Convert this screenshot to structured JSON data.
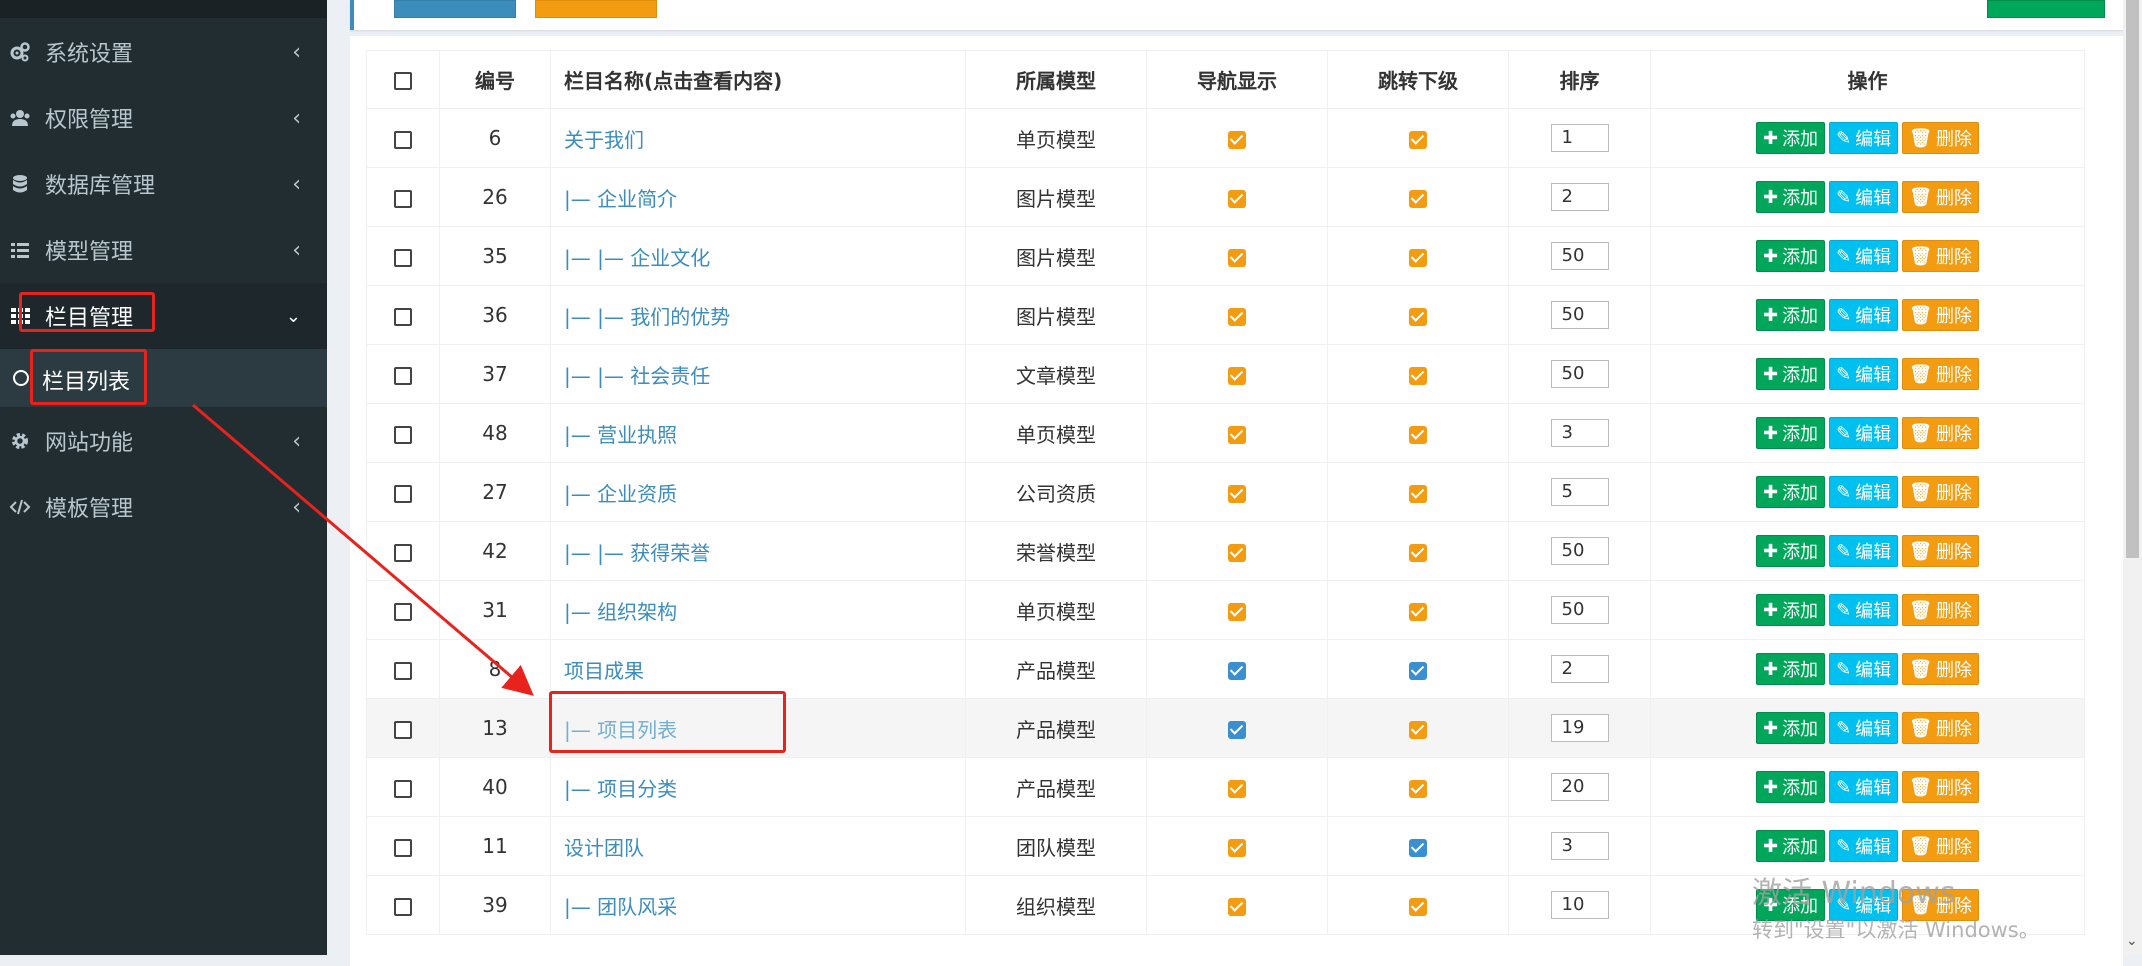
{
  "sidebar": {
    "items": [
      {
        "label": "系统设置",
        "icon": "cogs-icon"
      },
      {
        "label": "权限管理",
        "icon": "users-icon"
      },
      {
        "label": "数据库管理",
        "icon": "database-icon"
      },
      {
        "label": "模型管理",
        "icon": "list-icon"
      },
      {
        "label": "栏目管理",
        "icon": "grid-icon"
      },
      {
        "label": "网站功能",
        "icon": "gear-icon"
      },
      {
        "label": "模板管理",
        "icon": "code-icon"
      }
    ],
    "sub_item": {
      "label": "栏目列表"
    }
  },
  "table": {
    "headers": {
      "id": "编号",
      "name": "栏目名称(点击查看内容)",
      "model": "所属模型",
      "nav": "导航显示",
      "jump": "跳转下级",
      "sort": "排序",
      "ops": "操作"
    },
    "op_labels": {
      "add": "添加",
      "edit": "编辑",
      "delete": "删除"
    },
    "rows": [
      {
        "id": "6",
        "name": "关于我们",
        "model": "单页模型",
        "nav": "orange",
        "jump": "orange",
        "sort": "1"
      },
      {
        "id": "26",
        "name": "|— 企业简介",
        "model": "图片模型",
        "nav": "orange",
        "jump": "orange",
        "sort": "2"
      },
      {
        "id": "35",
        "name": "|— |— 企业文化",
        "model": "图片模型",
        "nav": "orange",
        "jump": "orange",
        "sort": "50"
      },
      {
        "id": "36",
        "name": "|— |— 我们的优势",
        "model": "图片模型",
        "nav": "orange",
        "jump": "orange",
        "sort": "50"
      },
      {
        "id": "37",
        "name": "|— |— 社会责任",
        "model": "文章模型",
        "nav": "orange",
        "jump": "orange",
        "sort": "50"
      },
      {
        "id": "48",
        "name": "|— 营业执照",
        "model": "单页模型",
        "nav": "orange",
        "jump": "orange",
        "sort": "3"
      },
      {
        "id": "27",
        "name": "|— 企业资质",
        "model": "公司资质",
        "nav": "orange",
        "jump": "orange",
        "sort": "5"
      },
      {
        "id": "42",
        "name": "|— |— 获得荣誉",
        "model": "荣誉模型",
        "nav": "orange",
        "jump": "orange",
        "sort": "50"
      },
      {
        "id": "31",
        "name": "|— 组织架构",
        "model": "单页模型",
        "nav": "orange",
        "jump": "orange",
        "sort": "50"
      },
      {
        "id": "8",
        "name": "项目成果",
        "model": "产品模型",
        "nav": "blue",
        "jump": "blue",
        "sort": "2"
      },
      {
        "id": "13",
        "name": "|— 项目列表",
        "model": "产品模型",
        "nav": "blue",
        "jump": "orange",
        "sort": "19"
      },
      {
        "id": "40",
        "name": "|— 项目分类",
        "model": "产品模型",
        "nav": "orange",
        "jump": "orange",
        "sort": "20"
      },
      {
        "id": "11",
        "name": "设计团队",
        "model": "团队模型",
        "nav": "orange",
        "jump": "blue",
        "sort": "3"
      },
      {
        "id": "39",
        "name": "|— 团队风采",
        "model": "组织模型",
        "nav": "orange",
        "jump": "orange",
        "sort": "10"
      }
    ]
  },
  "watermark": {
    "line1": "激活 Windows",
    "line2": "转到\"设置\"以激活 Windows。"
  },
  "colors": {
    "sidebar_bg": "#222d32",
    "link": "#3c8dbc",
    "check_orange": "#f39c12",
    "check_blue": "#3a8fd0",
    "annotation_red": "#e8231d"
  }
}
